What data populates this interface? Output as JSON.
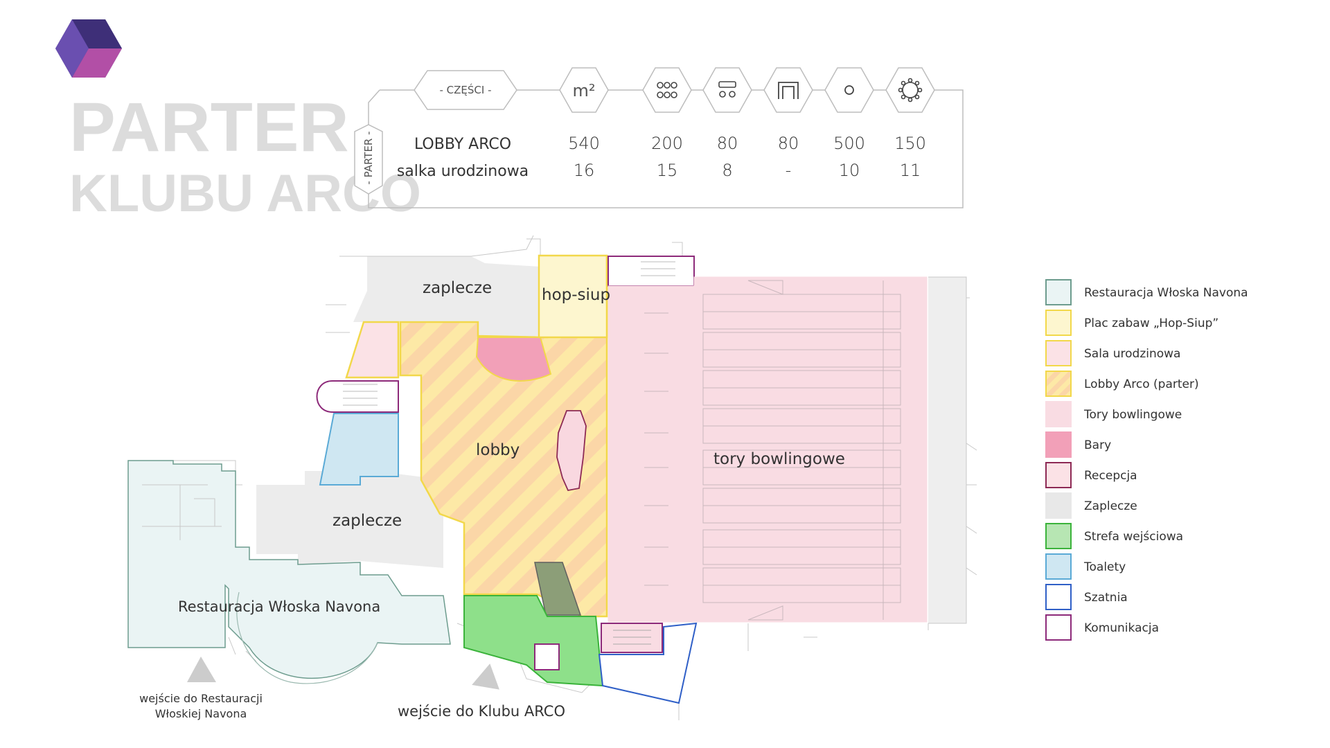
{
  "title": {
    "line1": "PARTER",
    "line2": "KLUBU ARCO"
  },
  "table": {
    "parts_header": "- CZĘŚCI -",
    "side_label": "- PARTER -",
    "area_header": "m²",
    "icons": [
      "area-icon",
      "theatre-seating-icon",
      "classroom-seating-icon",
      "u-shape-seating-icon",
      "cocktail-standing-icon",
      "banquet-round-table-icon"
    ],
    "rows": [
      {
        "name": "LOBBY ARCO",
        "values": [
          "540",
          "200",
          "80",
          "80",
          "500",
          "150"
        ]
      },
      {
        "name": "salka urodzinowa",
        "values": [
          "16",
          "15",
          "8",
          "-",
          "10",
          "11"
        ]
      }
    ]
  },
  "rooms": {
    "zaplecze_top": "zaplecze",
    "hop_siup": "hop-siup",
    "lobby": "lobby",
    "tory": "tory bowlingowe",
    "zaplecze_bottom": "zaplecze",
    "restauracja": "Restauracja Włoska Navona"
  },
  "entrances": {
    "restaurant_line1": "wejście do Restauracji",
    "restaurant_line2": "Włoskiej Navona",
    "club": "wejście do Klubu ARCO"
  },
  "legend": [
    {
      "label": "Restauracja Włoska Navona",
      "fill": "#eaf4f4",
      "stroke": "#6d9c8e"
    },
    {
      "label": "Plac zabaw „Hop-Siup”",
      "fill": "#fdf6cf",
      "stroke": "#f2d84a"
    },
    {
      "label": "Sala urodzinowa",
      "fill": "#fbe2e6",
      "stroke": "#f2d84a"
    },
    {
      "label": "Lobby Arco (parter)",
      "fill": "#fde7a8",
      "stroke": "#f2d84a"
    },
    {
      "label": "Tory bowlingowe",
      "fill": "#f9dce3",
      "stroke": "#f9dce3"
    },
    {
      "label": "Bary",
      "fill": "#f2a0b8",
      "stroke": "#f2a0b8"
    },
    {
      "label": "Recepcja",
      "fill": "#fbe2e6",
      "stroke": "#8d2a55"
    },
    {
      "label": "Zaplecze",
      "fill": "#e8e8e8",
      "stroke": "#e8e8e8"
    },
    {
      "label": "Strefa wejściowa",
      "fill": "#b7e6b3",
      "stroke": "#3bb33b"
    },
    {
      "label": "Toalety",
      "fill": "#cfe7f2",
      "stroke": "#5aaad6"
    },
    {
      "label": "Szatnia",
      "fill": "#ffffff",
      "stroke": "#2f5fc7"
    },
    {
      "label": "Komunikacja",
      "fill": "#ffffff",
      "stroke": "#8d2a7a"
    }
  ]
}
